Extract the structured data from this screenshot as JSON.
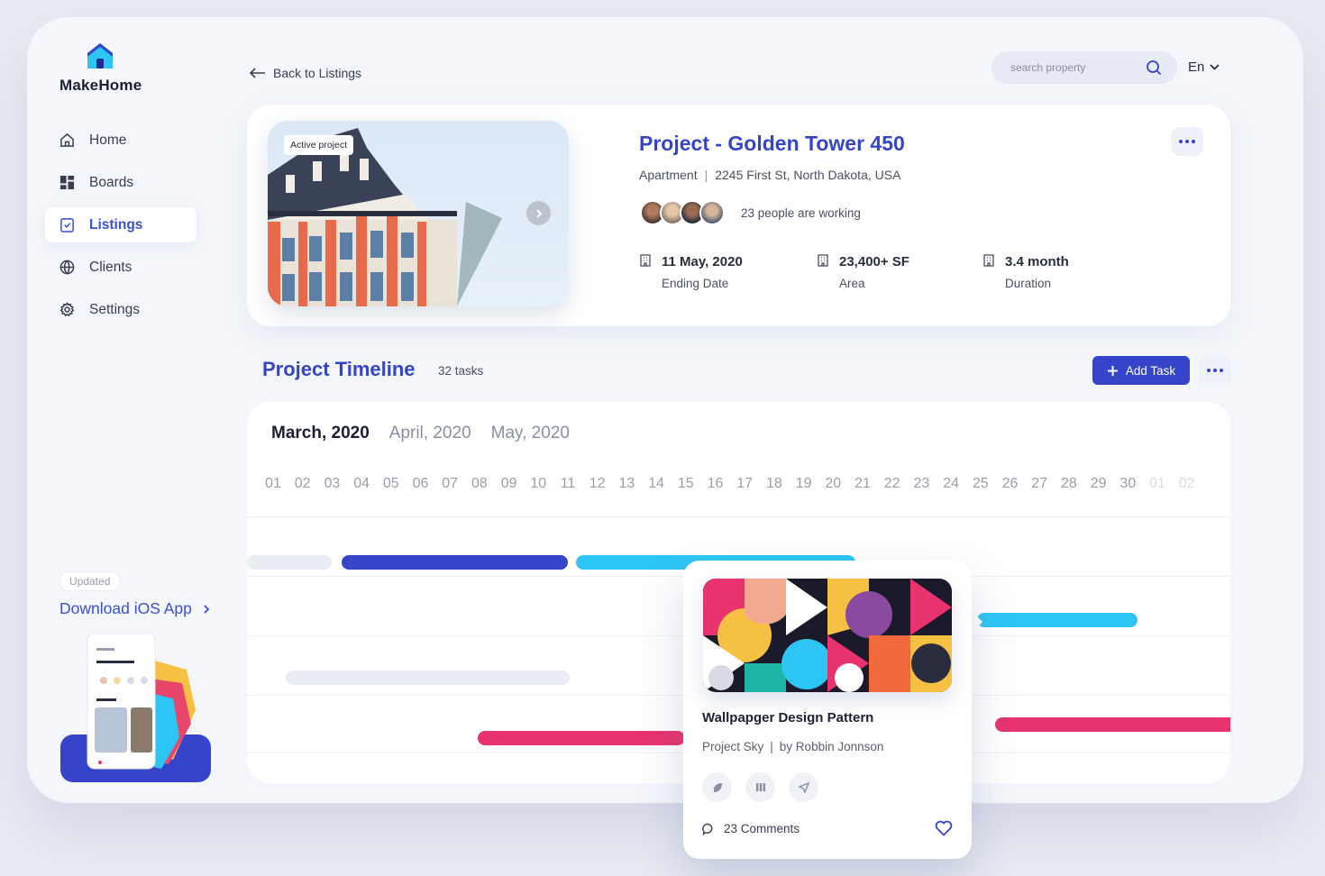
{
  "app": {
    "name": "MakeHome"
  },
  "colors": {
    "accent": "#3445c9",
    "cyan": "#2dc6f4",
    "pink": "#e8336e",
    "light_bar": "#eaeef4"
  },
  "sidebar": {
    "items": [
      {
        "label": "Home",
        "icon": "home-icon"
      },
      {
        "label": "Boards",
        "icon": "grid-icon"
      },
      {
        "label": "Listings",
        "icon": "clipboard-check-icon",
        "active": true
      },
      {
        "label": "Clients",
        "icon": "globe-icon"
      },
      {
        "label": "Settings",
        "icon": "gear-icon"
      }
    ],
    "updated_badge": "Updated",
    "download_label": "Download iOS App"
  },
  "header": {
    "back_label": "Back to Listings",
    "search_placeholder": "search property",
    "language": "En"
  },
  "project": {
    "badge": "Active project",
    "title": "Project - Golden Tower 450",
    "type": "Apartment",
    "address": "2245 First St, North Dakota, USA",
    "working_text": "23 people are working",
    "stats": [
      {
        "value": "11 May, 2020",
        "label": "Ending Date"
      },
      {
        "value": "23,400+ SF",
        "label": "Area"
      },
      {
        "value": "3.4 month",
        "label": "Duration"
      }
    ]
  },
  "timeline": {
    "title": "Project Timeline",
    "task_count": "32 tasks",
    "add_label": "Add Task",
    "months": [
      {
        "label": "March, 2020",
        "active": true
      },
      {
        "label": "April, 2020",
        "active": false
      },
      {
        "label": "May, 2020",
        "active": false
      }
    ],
    "days": [
      "01",
      "02",
      "03",
      "04",
      "05",
      "06",
      "07",
      "08",
      "09",
      "10",
      "11",
      "12",
      "13",
      "14",
      "15",
      "16",
      "17",
      "18",
      "19",
      "20",
      "21",
      "22",
      "23",
      "24",
      "25",
      "26",
      "27",
      "28",
      "29",
      "30",
      "01",
      "02"
    ]
  },
  "popup": {
    "title": "Wallpapger Design Pattern",
    "project": "Project Sky",
    "author": "by Robbin Jonnson",
    "comments": "23 Comments"
  }
}
